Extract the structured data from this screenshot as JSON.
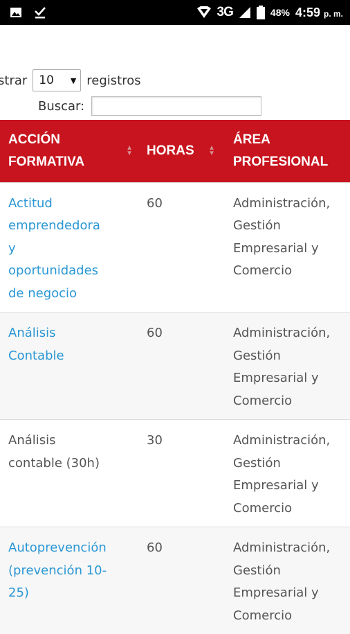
{
  "status_bar": {
    "network": "3G",
    "battery": "48%",
    "time": "4:59",
    "ampm": "p. m."
  },
  "controls": {
    "show_label": "ostrar",
    "length_value": "10",
    "records_label": "registros",
    "search_label": "Buscar:",
    "search_value": ""
  },
  "table": {
    "headers": {
      "accion_line1": "ACCIÓN",
      "accion_line2": "FORMATIVA",
      "horas": "HORAS",
      "area_line1": "ÁREA",
      "area_line2": "PROFESIONAL"
    },
    "rows": [
      {
        "accion_lines": [
          "Actitud",
          "emprendedora",
          "y",
          "oportunidades",
          "de negocio"
        ],
        "horas": "60",
        "area_lines": [
          "Administración,",
          "Gestión",
          "Empresarial y",
          "Comercio"
        ]
      },
      {
        "accion_lines": [
          "Análisis",
          "Contable"
        ],
        "horas": "60",
        "area_lines": [
          "Administración,",
          "Gestión",
          "Empresarial y",
          "Comercio"
        ]
      },
      {
        "accion_lines": [
          "Análisis",
          "contable (30h)"
        ],
        "horas": "30",
        "area_lines": [
          "Administración,",
          "Gestión",
          "Empresarial y",
          "Comercio"
        ]
      },
      {
        "accion_lines": [
          "Autoprevención",
          "(prevención 10-",
          "25)"
        ],
        "horas": "60",
        "area_lines": [
          "Administración,",
          "Gestión",
          "Empresarial y",
          "Comercio"
        ]
      }
    ]
  }
}
